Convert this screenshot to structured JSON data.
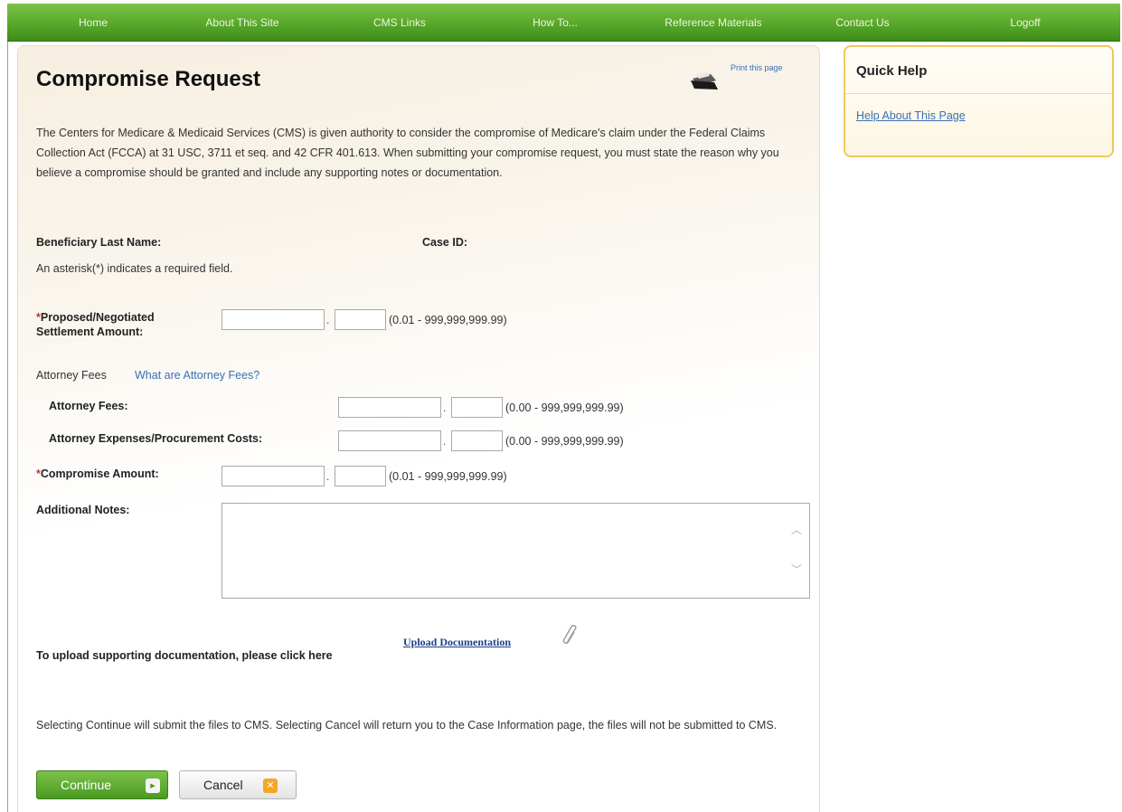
{
  "nav": {
    "items": [
      "Home",
      "About This Site",
      "CMS Links",
      "How To...",
      "Reference Materials",
      "Contact Us",
      "Logoff"
    ]
  },
  "page": {
    "title": "Compromise Request",
    "print_label": "Print this page",
    "intro": "The Centers for Medicare & Medicaid Services (CMS) is given authority to consider the compromise of Medicare's claim under the Federal Claims Collection Act (FCCA) at 31 USC, 3711 et seq. and 42 CFR 401.613. When submitting your compromise request, you must state the reason why you believe a compromise should be granted and include any supporting notes or documentation."
  },
  "case": {
    "beneficiary_label": "Beneficiary Last Name:",
    "case_id_label": "Case ID:"
  },
  "required_note": "An asterisk(*) indicates a required field.",
  "form": {
    "proposed": {
      "asterisk": "*",
      "label_line1": "Proposed/Negotiated",
      "label_line2": "Settlement Amount:",
      "range": "(0.01 - 999,999,999.99)"
    },
    "attorney_section": {
      "label": "Attorney Fees",
      "link": "What are Attorney Fees?"
    },
    "attorney_fees": {
      "label": "Attorney Fees:",
      "range": "(0.00 - 999,999,999.99)"
    },
    "attorney_expenses": {
      "label": "Attorney Expenses/Procurement Costs:",
      "range": "(0.00 - 999,999,999.99)"
    },
    "compromise": {
      "asterisk": "*",
      "label": "Compromise Amount:",
      "range": "(0.01 - 999,999,999.99)"
    },
    "notes": {
      "label": "Additional Notes:"
    },
    "decimal": "."
  },
  "upload": {
    "text": "To upload supporting documentation, please click here",
    "link": "Upload Documentation"
  },
  "submit_note": "Selecting Continue will submit the files to CMS. Selecting Cancel will return you to the Case Information page, the files will not be submitted to CMS.",
  "buttons": {
    "continue": "Continue",
    "continue_icon": "▸",
    "cancel": "Cancel",
    "cancel_icon": "✕"
  },
  "quick_help": {
    "title": "Quick Help",
    "link": "Help About This Page"
  },
  "icons": {
    "print": "printer-icon",
    "paperclip": "paperclip-icon",
    "scroll_up": "scroll-up-icon",
    "scroll_down": "scroll-down-icon"
  },
  "colors": {
    "nav_green": "#58a82a",
    "link_blue": "#3a6fb5",
    "required_red": "#c0392b",
    "help_border": "#f0c85a"
  }
}
